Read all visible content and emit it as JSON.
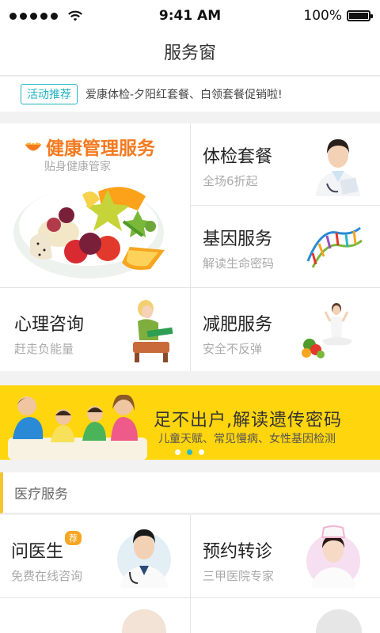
{
  "status_bar": {
    "time": "9:41 AM",
    "battery": "100%",
    "signal_bars": 5
  },
  "nav": {
    "title": "服务窗"
  },
  "promo": {
    "tag": "活动推荐",
    "text": "爱康体检-夕阳红套餐、白领套餐促销啦!"
  },
  "services": {
    "health": {
      "title": "健康管理服务",
      "subtitle": "贴身健康管家"
    },
    "checkup": {
      "title": "体检套餐",
      "subtitle": "全场6折起"
    },
    "gene": {
      "title": "基因服务",
      "subtitle": "解读生命密码"
    },
    "psych": {
      "title": "心理咨询",
      "subtitle": "赶走负能量"
    },
    "diet": {
      "title": "减肥服务",
      "subtitle": "安全不反弹"
    }
  },
  "banner": {
    "title": "足不出户,解读遗传密码",
    "subtitle": "儿童天赋、常见慢病、女性基因检测",
    "active_page": 2,
    "pages": 3
  },
  "medical": {
    "section_title": "医疗服务",
    "ask_doctor": {
      "title": "问医生",
      "badge": "荐",
      "subtitle": "免费在线咨询"
    },
    "referral": {
      "title": "预约转诊",
      "subtitle": "三甲医院专家"
    }
  },
  "colors": {
    "accent_orange": "#f47a20",
    "teal": "#23b5c3",
    "banner_yellow": "#ffd50d",
    "badge_orange": "#f6a623"
  }
}
